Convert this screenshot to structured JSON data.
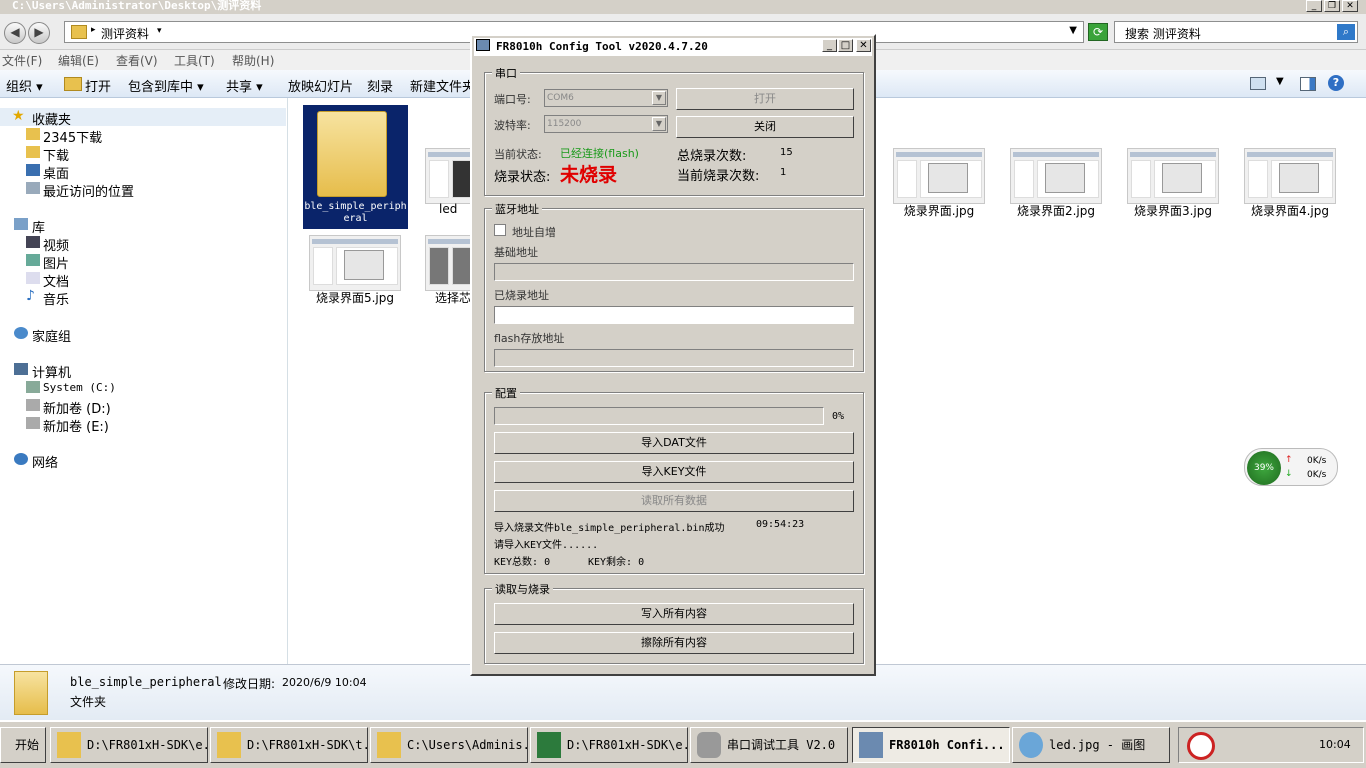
{
  "explorer": {
    "title_path": "C:\\Users\\Administrator\\Desktop\\测评资料",
    "breadcrumb": "测评资料",
    "search_placeholder": "搜索 测评资料",
    "menu": [
      "文件(F)",
      "编辑(E)",
      "查看(V)",
      "工具(T)",
      "帮助(H)"
    ],
    "commands": [
      "组织",
      "打开",
      "包含到库中",
      "共享",
      "放映幻灯片",
      "刻录",
      "新建文件夹"
    ],
    "nav": {
      "favorites": "收藏夹",
      "fav_items": [
        "2345下载",
        "下载",
        "桌面",
        "最近访问的位置"
      ],
      "libraries": "库",
      "lib_items": [
        "视频",
        "图片",
        "文档",
        "音乐"
      ],
      "homegroup": "家庭组",
      "computer": "计算机",
      "drives": [
        "System (C:)",
        "新加卷 (D:)",
        "新加卷 (E:)"
      ],
      "network": "网络"
    },
    "files": {
      "folder_name": "ble_simple_peripheral",
      "f2": "led",
      "f3": "烧录界面.jpg",
      "f4": "烧录界面2.jpg",
      "f5": "烧录界面3.jpg",
      "f6": "烧录界面4.jpg",
      "f7": "烧录界面5.jpg",
      "f8": "选择芯"
    },
    "details": {
      "name": "ble_simple_peripheral",
      "modified_label": "修改日期:",
      "modified": "2020/6/9 10:04",
      "type": "文件夹"
    }
  },
  "dialog": {
    "title": "FR8010h Config Tool v2020.4.7.20",
    "serial_group": "串口",
    "port_label": "端口号:",
    "port_value": "COM6",
    "baud_label": "波特率:",
    "baud_value": "115200",
    "open_btn": "打开",
    "close_btn": "关闭",
    "current_status_label": "当前状态:",
    "current_status_value": "已经连接(flash)",
    "burn_status_label": "烧录状态:",
    "burn_status_value": "未烧录",
    "total_burn_label": "总烧录次数:",
    "total_burn_value": "15",
    "cur_burn_label": "当前烧录次数:",
    "cur_burn_value": "1",
    "bt_group": "蓝牙地址",
    "auto_inc_label": "地址自增",
    "base_addr_label": "基础地址",
    "burned_addr_label": "已烧录地址",
    "flash_addr_label": "flash存放地址",
    "config_group": "配置",
    "progress_text": "0%",
    "progress_value": 0,
    "import_dat_btn": "导入DAT文件",
    "import_key_btn": "导入KEY文件",
    "read_all_btn": "读取所有数据",
    "log1": "导入烧录文件ble_simple_peripheral.bin成功",
    "log1_time": "09:54:23",
    "log2": "请导入KEY文件......",
    "key_total": "KEY总数: 0",
    "key_remain": "KEY剩余: 0",
    "rw_group": "读取与烧录",
    "write_all_btn": "写入所有内容",
    "erase_all_btn": "擦除所有内容"
  },
  "netmeter": {
    "percent": "39%",
    "up": "0K/s",
    "down": "0K/s"
  },
  "taskbar": {
    "start": "开始",
    "tasks": [
      "D:\\FR801xH-SDK\\e...",
      "D:\\FR801xH-SDK\\t...",
      "C:\\Users\\Adminis...",
      "D:\\FR801xH-SDK\\e...",
      "串口调试工具 V2.0",
      "FR8010h Confi...",
      "led.jpg - 画图"
    ],
    "clock": "10:04"
  },
  "colors": {
    "status_green": "#1a9a1a",
    "burn_red": "#e00000",
    "selection": "#0a246a"
  }
}
